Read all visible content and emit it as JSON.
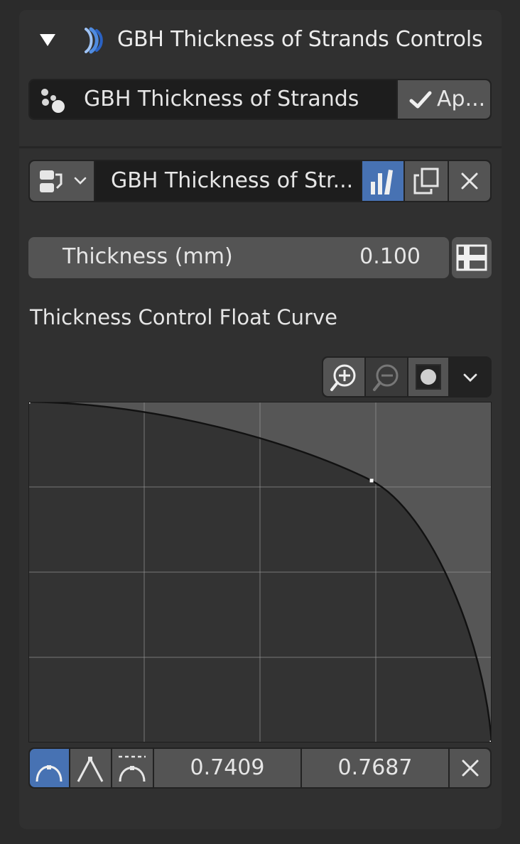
{
  "panel": {
    "title": "GBH Thickness of Strands Controls",
    "collapse_icon": "triangle-down-icon",
    "addon_icon": "gbh-logo-icon"
  },
  "modifier_row": {
    "icon": "particles-icon",
    "name": "GBH Thickness of Strands",
    "apply_label": "Ap..."
  },
  "node_group_row": {
    "type_icon": "node-tree-icon",
    "name": "GBH Thickness of Str...",
    "fake_user_icon": "fake-user-icon",
    "duplicate_icon": "duplicate-icon",
    "unlink_icon": "close-icon"
  },
  "thickness": {
    "label": "Thickness (mm)",
    "value": "0.100",
    "attribute_toggle_icon": "input-attribute-icon"
  },
  "curve": {
    "label": "Thickness Control Float Curve",
    "toolbar": {
      "zoom_in_icon": "zoom-in-icon",
      "zoom_out_icon": "zoom-out-icon",
      "clip_icon": "clip-record-icon",
      "menu_icon": "chevron-down-icon"
    },
    "points": [
      {
        "x": 0.0,
        "y": 1.0
      },
      {
        "x": 0.7409,
        "y": 0.7687
      },
      {
        "x": 1.0,
        "y": 0.0
      }
    ],
    "selected_point": {
      "x": "0.7409",
      "y": "0.7687"
    },
    "handle_types": [
      "auto-handle-icon",
      "vector-handle-icon",
      "auto-clamped-handle-icon"
    ],
    "delete_icon": "close-icon"
  },
  "colors": {
    "panel_bg": "#303030",
    "field_bg": "#3d3d3d",
    "dark_field": "#1d1d1d",
    "accent": "#4772b3",
    "curve_fill": "#333333",
    "curve_bg": "#565656"
  }
}
